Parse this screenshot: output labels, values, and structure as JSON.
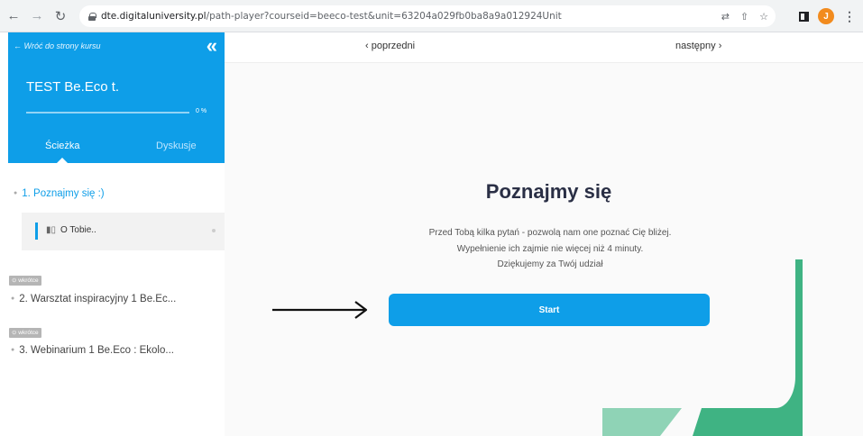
{
  "browser": {
    "url_domain": "dte.digitaluniversity.pl",
    "url_path": "/path-player?courseid=beeco-test&unit=63204a029fb0ba8a9a012924Unit",
    "avatar_letter": "J"
  },
  "sidebar": {
    "back_label": "← Wróć do strony kursu",
    "course_title": "TEST Be.Eco t.",
    "progress_percent": 0,
    "progress_label": "0 %",
    "tabs": [
      {
        "label": "Ścieżka"
      },
      {
        "label": "Dyskusje"
      }
    ],
    "sections": [
      {
        "label": "1. Poznajmy się :)"
      },
      {
        "label": "2. Warsztat inspiracyjny 1 Be.Ec...",
        "badge": "wkrótce"
      },
      {
        "label": "3. Webinarium 1 Be.Eco : Ekolo...",
        "badge": "wkrótce"
      }
    ],
    "unit": {
      "label": "O Tobie..",
      "icon": "chart-icon"
    }
  },
  "topnav": {
    "prev_label": "‹ poprzedni",
    "next_label": "następny ›"
  },
  "main": {
    "title": "Poznajmy się",
    "description": [
      "Przed Tobą kilka pytań - pozwolą nam one poznać Cię bliżej.",
      "Wypełnienie ich zajmie nie więcej niż 4 minuty.",
      "Dziękujemy za Twój udział"
    ],
    "start_label": "Start"
  },
  "colors": {
    "accent": "#0e9ee8",
    "deco_dark": "#3fb383",
    "deco_light": "#8fd3b6"
  }
}
